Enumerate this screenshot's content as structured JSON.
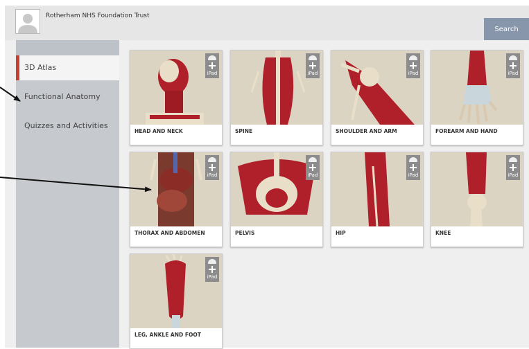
{
  "header": {
    "org_name": "Rotherham NHS Foundation Trust",
    "search_label": "Search"
  },
  "sidebar": {
    "items": [
      {
        "label": "3D Atlas",
        "active": true
      },
      {
        "label": "Functional Anatomy",
        "active": false
      },
      {
        "label": "Quizzes and Activities",
        "active": false
      }
    ]
  },
  "tiles": [
    {
      "label": "HEAD AND NECK",
      "badge_text": "iPad"
    },
    {
      "label": "SPINE",
      "badge_text": "iPad"
    },
    {
      "label": "SHOULDER AND ARM",
      "badge_text": "iPad"
    },
    {
      "label": "FOREARM AND HAND",
      "badge_text": "iPad"
    },
    {
      "label": "THORAX AND ABDOMEN",
      "badge_text": "iPad"
    },
    {
      "label": "PELVIS",
      "badge_text": "iPad"
    },
    {
      "label": "HIP",
      "badge_text": "iPad"
    },
    {
      "label": "KNEE",
      "badge_text": "iPad"
    },
    {
      "label": "LEG, ANKLE AND FOOT",
      "badge_text": "iPad"
    }
  ],
  "colors": {
    "accent": "#c6412d",
    "search_button": "#8796aa",
    "sidebar": "#c6c9ce",
    "tile_image_bg": "#dcd4c3",
    "muscle": "#b0202a"
  },
  "icons": [
    "user-avatar-icon",
    "android-icon",
    "plus-icon"
  ]
}
